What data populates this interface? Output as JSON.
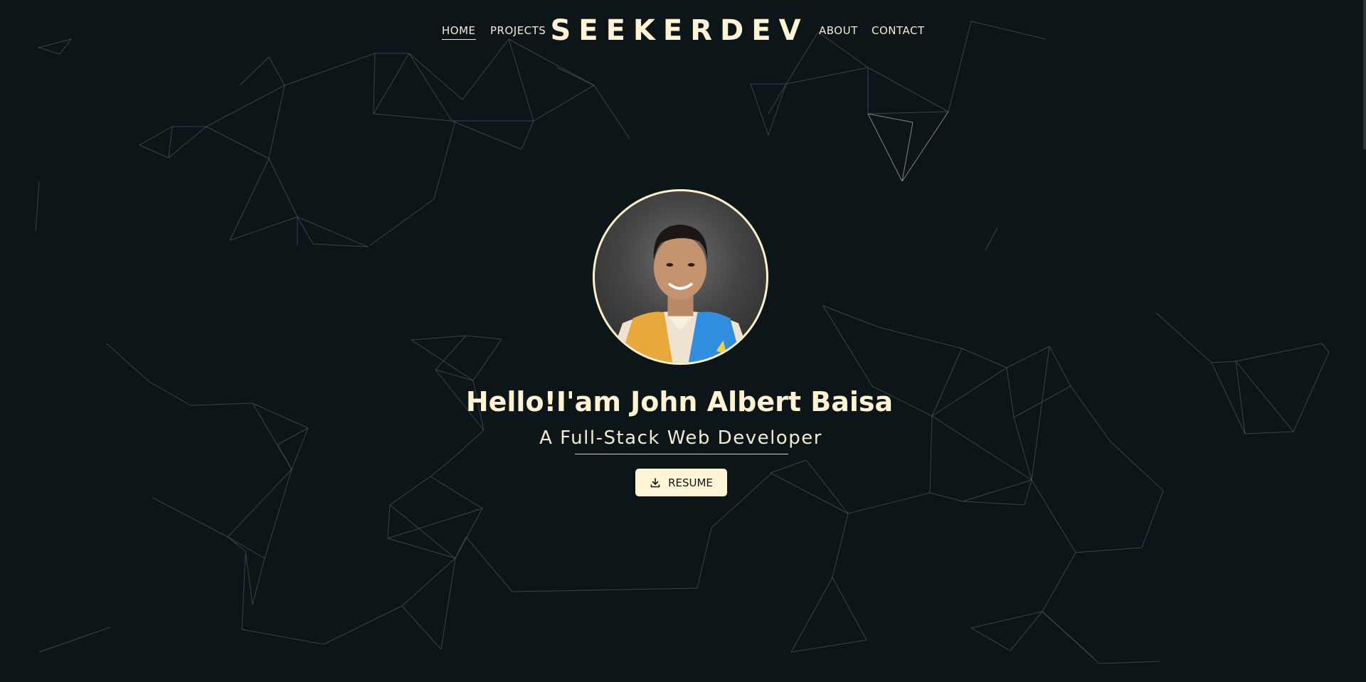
{
  "nav": {
    "home": "HOME",
    "projects": "PROJECTS",
    "about": "ABOUT",
    "contact": "CONTACT",
    "active": "home"
  },
  "brand": "SEEKERDEV",
  "hero": {
    "headline": "Hello!I'am John Albert Baisa",
    "subtitle": "A Full-Stack Web Developer",
    "resume_button": "RESUME",
    "resume_icon": "download-icon"
  },
  "colors": {
    "background": "#0c1518",
    "accent": "#fff5d6",
    "text": "#f3ecd4"
  }
}
